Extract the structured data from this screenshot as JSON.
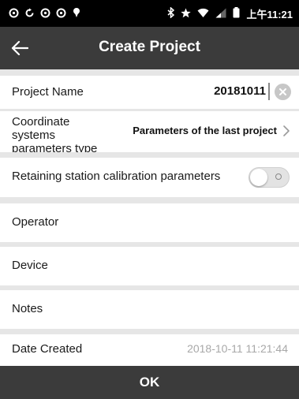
{
  "status_bar": {
    "time": "上午11:21"
  },
  "header": {
    "title": "Create Project"
  },
  "form": {
    "project_name": {
      "label": "Project Name",
      "value": "20181011"
    },
    "coordinate_systems": {
      "label": "Coordinate systems parameters type",
      "value": "Parameters of the last project"
    },
    "retain_calibration": {
      "label": "Retaining station calibration parameters",
      "enabled": false
    },
    "operator": {
      "label": "Operator",
      "value": ""
    },
    "device": {
      "label": "Device",
      "value": ""
    },
    "notes": {
      "label": "Notes",
      "value": ""
    },
    "date_created": {
      "label": "Date Created",
      "value": "2018-10-11 11:21:44"
    }
  },
  "footer": {
    "ok_label": "OK"
  },
  "colors": {
    "app_bar": "#3b3b3b",
    "status_bar": "#000000",
    "separator": "#e6e6e6",
    "muted_text": "#a8a8a8"
  },
  "icons": {
    "back": "arrow-left-icon",
    "clear": "clear-circle-icon",
    "chevron": "chevron-right-icon"
  }
}
